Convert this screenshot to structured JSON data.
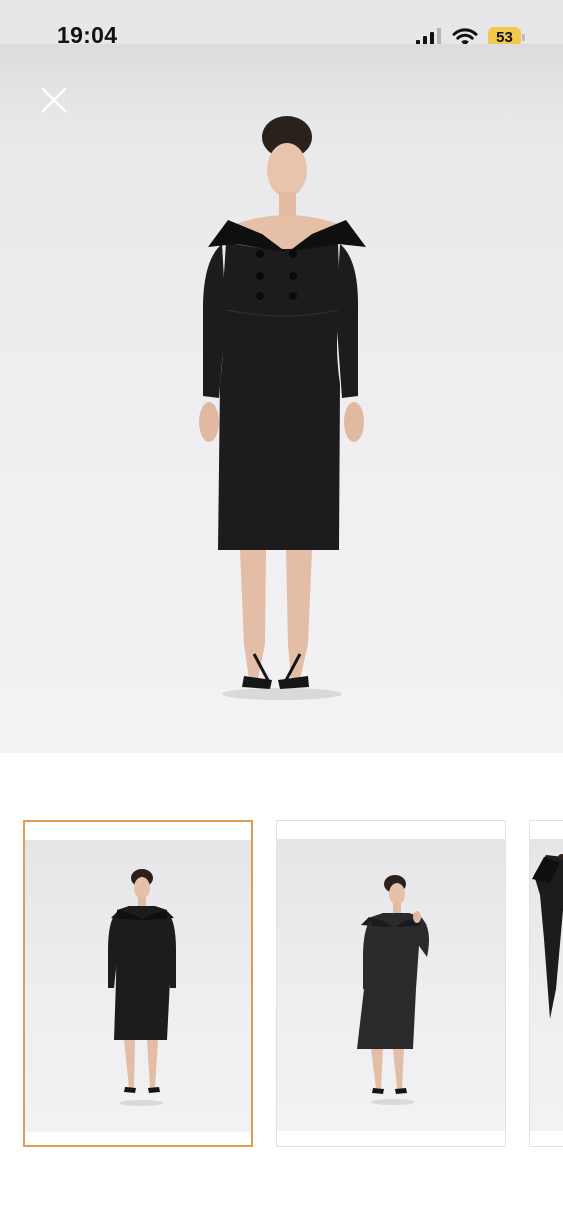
{
  "status_bar": {
    "time": "19:04",
    "battery_level": "53",
    "icons": [
      "cellular-signal-icon",
      "wifi-icon",
      "battery-icon"
    ]
  },
  "viewer": {
    "close_icon": "close-icon",
    "selected_index": 0,
    "thumbnail_count": 3
  },
  "colors": {
    "selected_border": "#e29a55",
    "battery_fill": "#f2c94c",
    "dress": "#1c1c1e"
  }
}
